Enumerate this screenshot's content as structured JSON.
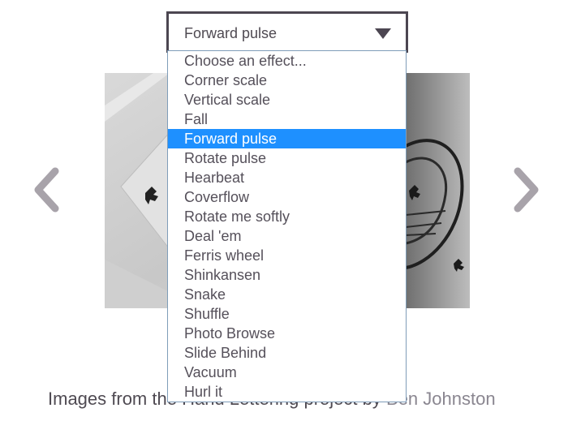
{
  "effect_select": {
    "value": "Forward pulse",
    "options": [
      "Choose an effect...",
      "Corner scale",
      "Vertical scale",
      "Fall",
      "Forward pulse",
      "Rotate pulse",
      "Hearbeat",
      "Coverflow",
      "Rotate me softly",
      "Deal 'em",
      "Ferris wheel",
      "Shinkansen",
      "Snake",
      "Shuffle",
      "Photo Browse",
      "Slide Behind",
      "Vacuum",
      "Hurl it"
    ],
    "selected_index": 4
  },
  "caption": {
    "prefix": "Images from the Hand Lettering project by",
    "author": "Ben Johnston"
  },
  "colors": {
    "accent": "#1e90ff",
    "border": "#4c4651",
    "nav_arrow": "#a8a3aa"
  },
  "icons": {
    "prev": "chevron-left-icon",
    "next": "chevron-right-icon",
    "dropdown": "triangle-down-icon"
  }
}
